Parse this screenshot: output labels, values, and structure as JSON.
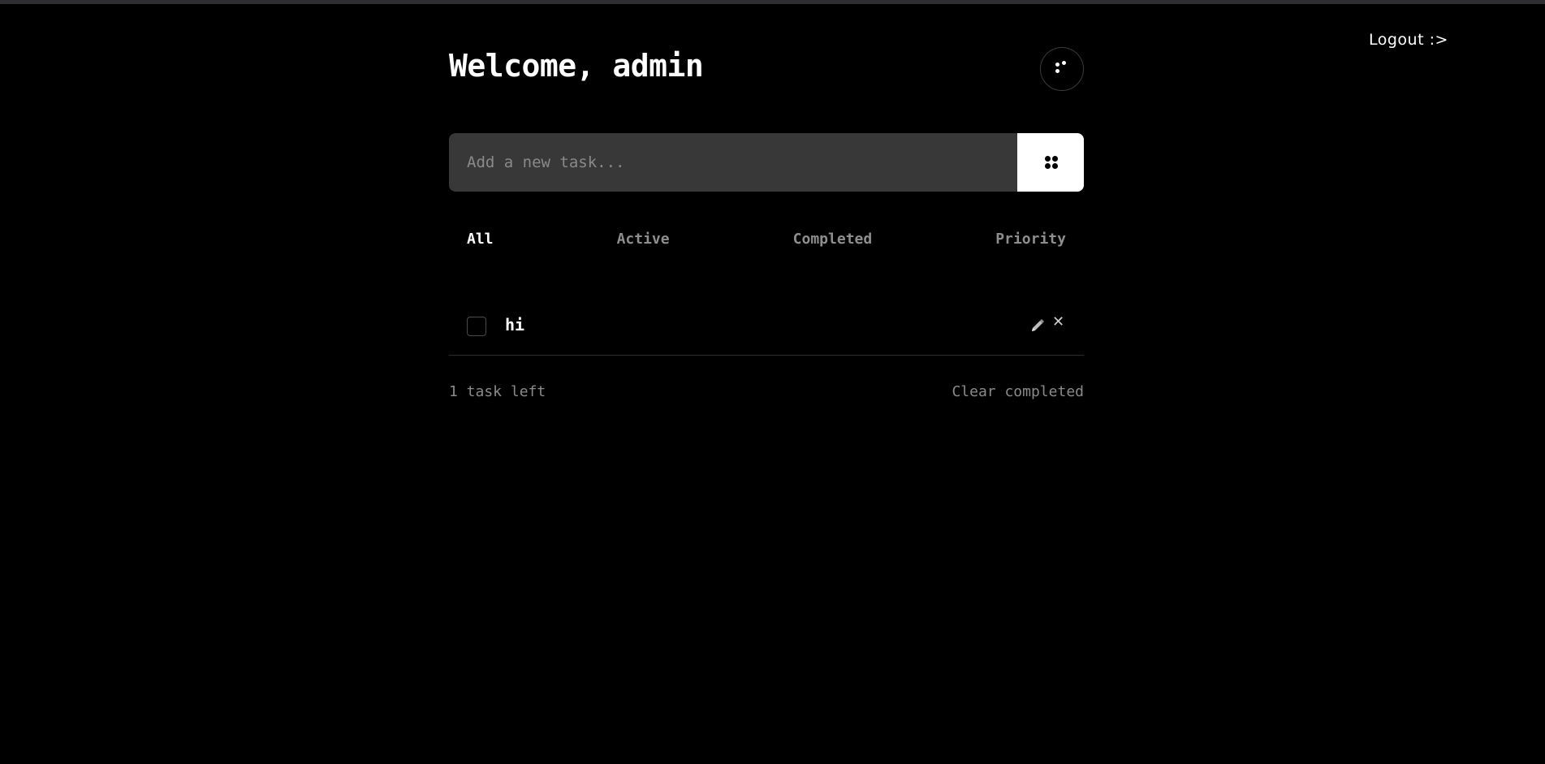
{
  "header": {
    "title": "Welcome, admin",
    "logout_label": "Logout :>"
  },
  "new_task": {
    "placeholder": "Add a new task...",
    "value": ""
  },
  "filters": [
    {
      "label": "All",
      "active": true
    },
    {
      "label": "Active",
      "active": false
    },
    {
      "label": "Completed",
      "active": false
    },
    {
      "label": "Priority",
      "active": false
    }
  ],
  "tasks": [
    {
      "text": "hi",
      "completed": false
    }
  ],
  "footer": {
    "tasks_left": "1 task left",
    "clear_label": "Clear completed"
  },
  "icons": {
    "theme_toggle": "dots-icon",
    "add": "dots-grid-icon",
    "edit": "pencil-icon",
    "delete": "close-icon"
  },
  "colors": {
    "background": "#000000",
    "input_bg": "#383838",
    "accent": "#ffffff",
    "muted_text": "#8a8a8a"
  }
}
